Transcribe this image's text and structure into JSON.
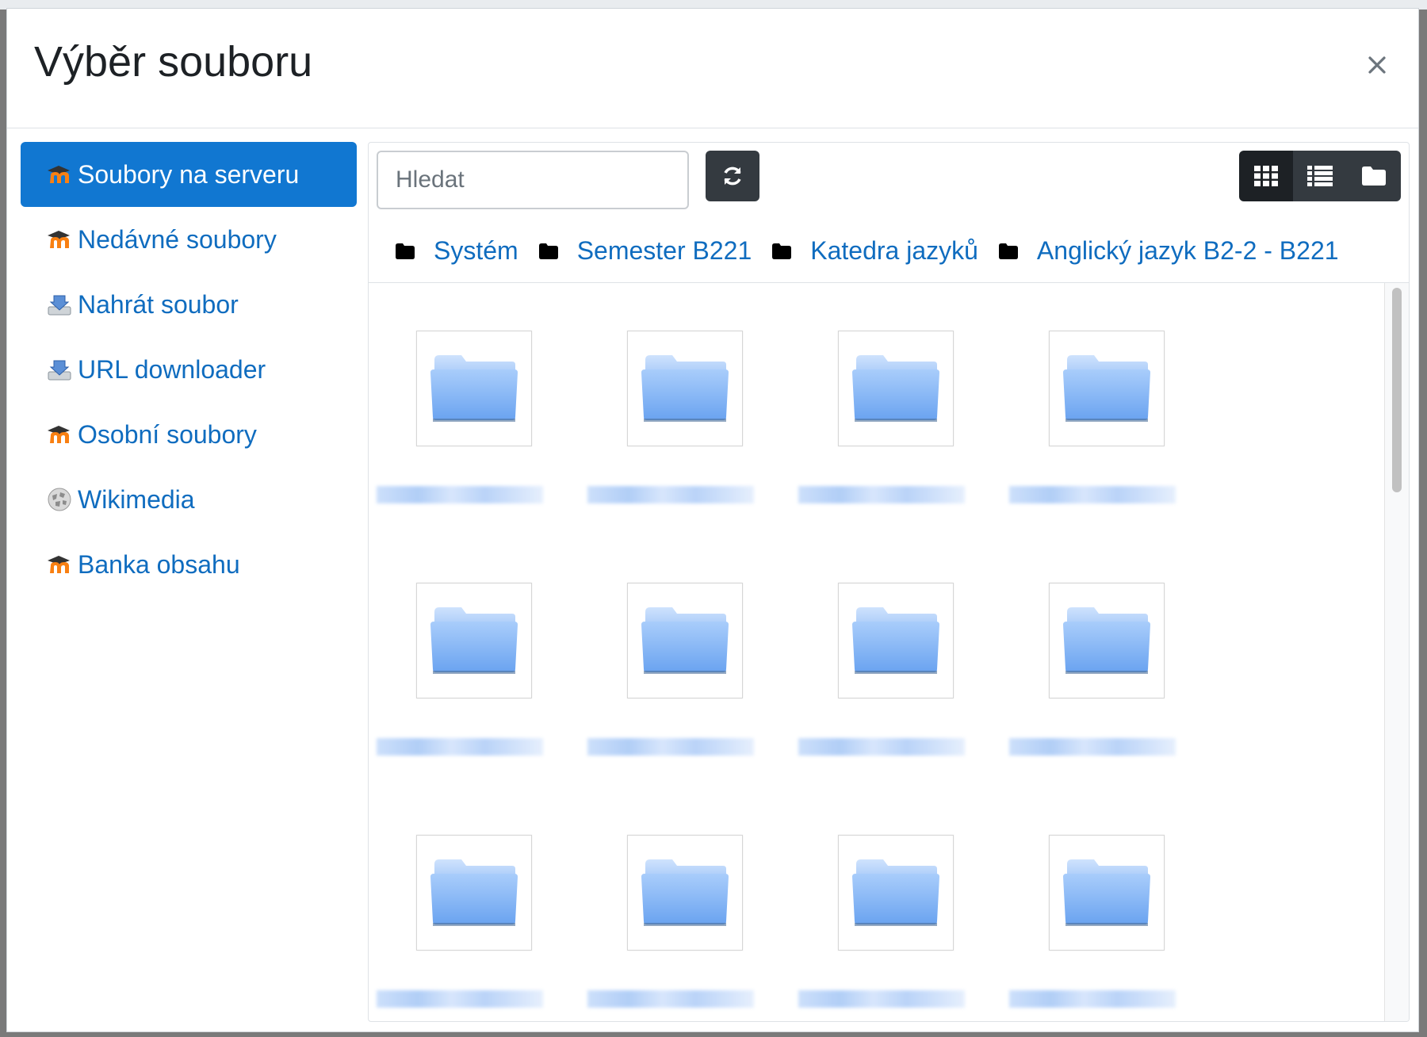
{
  "dialog": {
    "title": "Výběr souboru"
  },
  "sidebar": {
    "items": [
      {
        "label": "Soubory na serveru",
        "icon": "moodle-icon",
        "active": true
      },
      {
        "label": "Nedávné soubory",
        "icon": "moodle-icon",
        "active": false
      },
      {
        "label": "Nahrát soubor",
        "icon": "upload-icon",
        "active": false
      },
      {
        "label": "URL downloader",
        "icon": "upload-icon",
        "active": false
      },
      {
        "label": "Osobní soubory",
        "icon": "moodle-icon",
        "active": false
      },
      {
        "label": "Wikimedia",
        "icon": "wikimedia-icon",
        "active": false
      },
      {
        "label": "Banka obsahu",
        "icon": "moodle-icon",
        "active": false
      }
    ]
  },
  "toolbar": {
    "search_placeholder": "Hledat",
    "view_modes": [
      "grid",
      "list",
      "folder"
    ],
    "active_view": "grid"
  },
  "breadcrumb": [
    {
      "label": "Systém"
    },
    {
      "label": "Semester B221"
    },
    {
      "label": "Katedra jazyků"
    },
    {
      "label": "Anglický jazyk B2-2 - B221"
    }
  ],
  "files": {
    "count_visible": 12,
    "type": "folder"
  },
  "colors": {
    "accent": "#1177d1",
    "link": "#0f6cbf",
    "dark_button": "#343a40"
  }
}
